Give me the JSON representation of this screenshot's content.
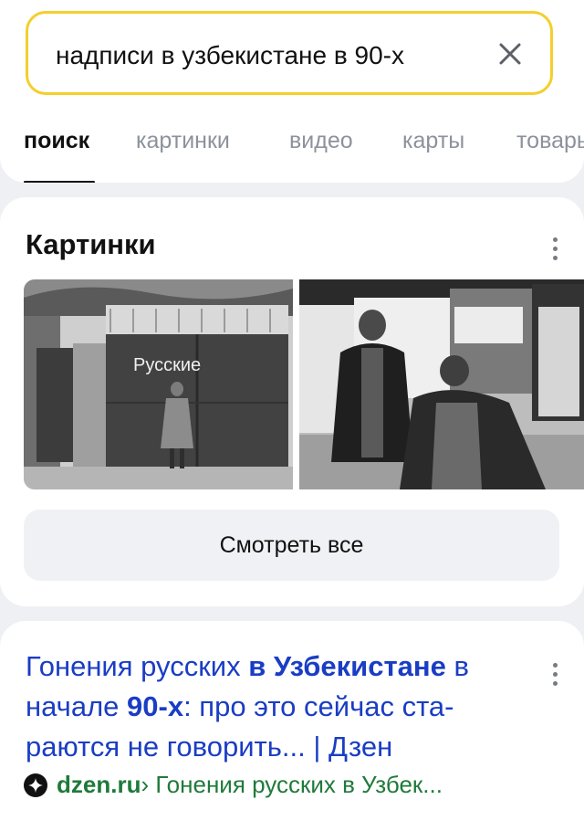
{
  "search": {
    "query": "надписи в узбекистане в 90-х"
  },
  "tabs": [
    {
      "label": "поиск"
    },
    {
      "label": "картинки"
    },
    {
      "label": "видео"
    },
    {
      "label": "карты"
    },
    {
      "label": "товары"
    }
  ],
  "images_section": {
    "title": "Картинки",
    "photo1_text": "Русские",
    "see_all_label": "Смотреть все"
  },
  "result": {
    "title_part1": "Гонения русских",
    "title_bold1": "в Узбекистане",
    "title_part2": "в",
    "title_line2a": "начале",
    "title_bold2": "90-х",
    "title_part3": ": про это сейчас ста-раются не говорить... | Дзен",
    "domain": "dzen.ru",
    "breadcrumb": "› Гонения русских в Узбек..."
  },
  "colors": {
    "search_border": "#f4cf2c",
    "link_blue": "#1a3dc4",
    "domain_green": "#1f7a3a"
  }
}
